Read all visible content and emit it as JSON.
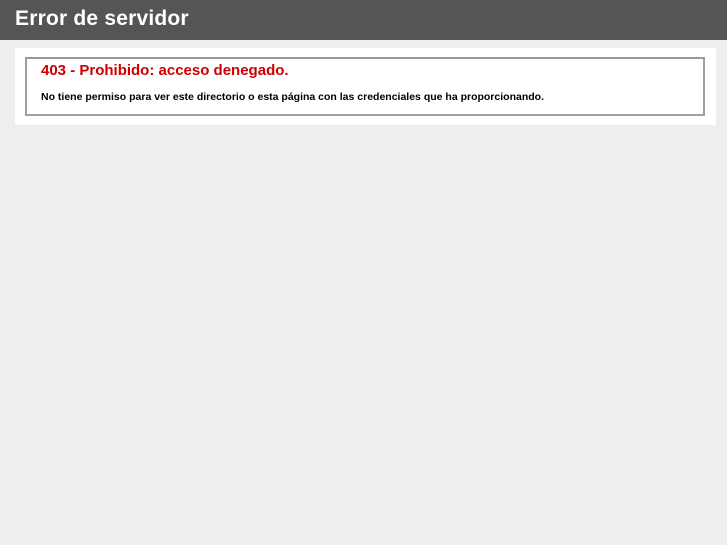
{
  "header": {
    "title": "Error de servidor"
  },
  "error": {
    "heading": "403 - Prohibido: acceso denegado.",
    "message": "No tiene permiso para ver este directorio o esta página con las credenciales que ha proporcionando."
  },
  "colors": {
    "header_bg": "#555555",
    "error_red": "#cc0000",
    "page_bg": "#eeeeee"
  }
}
